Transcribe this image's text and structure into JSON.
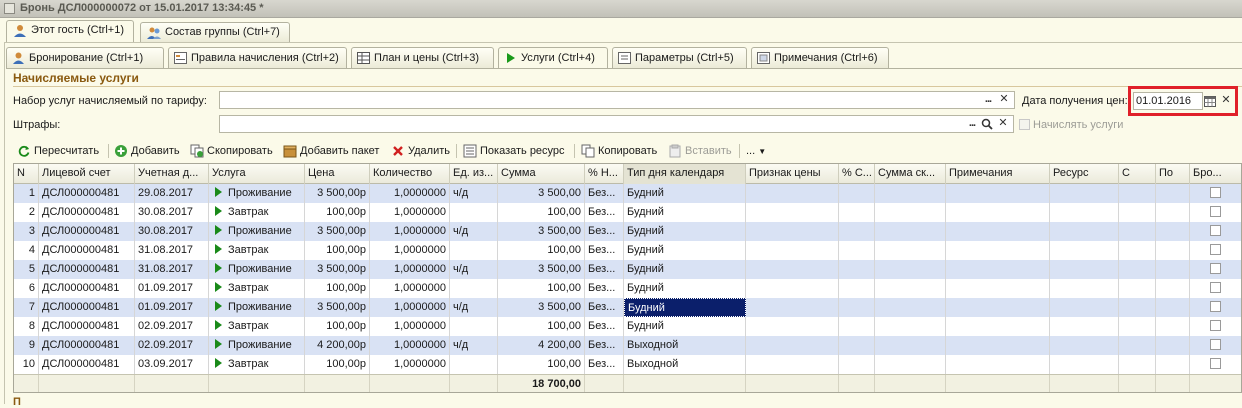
{
  "window": {
    "title": "Бронь ДСЛ000000072 от 15.01.2017 13:34:45 *"
  },
  "top_tabs": [
    {
      "label": "Этот гость (Ctrl+1)",
      "icon": "person-icon",
      "active": true
    },
    {
      "label": "Состав группы (Ctrl+7)",
      "icon": "group-icon",
      "active": false
    }
  ],
  "inner_tabs": [
    {
      "label": "Бронирование (Ctrl+1)",
      "icon": "person-icon",
      "active": false
    },
    {
      "label": "Правила начисления (Ctrl+2)",
      "icon": "rules-icon",
      "active": false
    },
    {
      "label": "План и цены (Ctrl+3)",
      "icon": "table-icon",
      "active": false
    },
    {
      "label": "Услуги (Ctrl+4)",
      "icon": "play-icon",
      "active": true
    },
    {
      "label": "Параметры (Ctrl+5)",
      "icon": "params-icon",
      "active": false
    },
    {
      "label": "Примечания (Ctrl+6)",
      "icon": "notes-icon",
      "active": false
    }
  ],
  "section": {
    "title": "Начисляемые услуги"
  },
  "form": {
    "tariff_label": "Набор услуг начисляемый по тарифу:",
    "tariff_value": "",
    "fines_label": "Штрафы:",
    "fines_value": "",
    "date_label": "Дата получения цен:",
    "date_value": "01.01.2016",
    "charge_services_label": "Начислять услуги",
    "charge_services_checked": false,
    "dots": "..."
  },
  "toolbar": {
    "recalc": "Пересчитать",
    "add": "Добавить",
    "copy": "Скопировать",
    "add_package": "Добавить пакет",
    "delete": "Удалить",
    "show_resource": "Показать ресурс",
    "copy2": "Копировать",
    "paste": "Вставить",
    "more": "..."
  },
  "grid": {
    "columns": [
      "N",
      "Лицевой счет",
      "Учетная д...",
      "Услуга",
      "Цена",
      "Количество",
      "Ед. из...",
      "Сумма",
      "% Н...",
      "Тип дня календаря",
      "Признак цены",
      "% С...",
      "Сумма ск...",
      "Примечания",
      "Ресурс",
      "С",
      "По",
      "Бро..."
    ],
    "rows": [
      {
        "n": "1",
        "account": "ДСЛ000000481",
        "date": "29.08.2017",
        "service": "Проживание",
        "price": "3 500,00р",
        "qty": "1,0000000",
        "unit": "ч/д",
        "sum": "3 500,00",
        "vat": "Без...",
        "daytype": "Будний"
      },
      {
        "n": "2",
        "account": "ДСЛ000000481",
        "date": "30.08.2017",
        "service": "Завтрак",
        "price": "100,00р",
        "qty": "1,0000000",
        "unit": "",
        "sum": "100,00",
        "vat": "Без...",
        "daytype": "Будний"
      },
      {
        "n": "3",
        "account": "ДСЛ000000481",
        "date": "30.08.2017",
        "service": "Проживание",
        "price": "3 500,00р",
        "qty": "1,0000000",
        "unit": "ч/д",
        "sum": "3 500,00",
        "vat": "Без...",
        "daytype": "Будний"
      },
      {
        "n": "4",
        "account": "ДСЛ000000481",
        "date": "31.08.2017",
        "service": "Завтрак",
        "price": "100,00р",
        "qty": "1,0000000",
        "unit": "",
        "sum": "100,00",
        "vat": "Без...",
        "daytype": "Будний"
      },
      {
        "n": "5",
        "account": "ДСЛ000000481",
        "date": "31.08.2017",
        "service": "Проживание",
        "price": "3 500,00р",
        "qty": "1,0000000",
        "unit": "ч/д",
        "sum": "3 500,00",
        "vat": "Без...",
        "daytype": "Будний"
      },
      {
        "n": "6",
        "account": "ДСЛ000000481",
        "date": "01.09.2017",
        "service": "Завтрак",
        "price": "100,00р",
        "qty": "1,0000000",
        "unit": "",
        "sum": "100,00",
        "vat": "Без...",
        "daytype": "Будний"
      },
      {
        "n": "7",
        "account": "ДСЛ000000481",
        "date": "01.09.2017",
        "service": "Проживание",
        "price": "3 500,00р",
        "qty": "1,0000000",
        "unit": "ч/д",
        "sum": "3 500,00",
        "vat": "Без...",
        "daytype": "Будний"
      },
      {
        "n": "8",
        "account": "ДСЛ000000481",
        "date": "02.09.2017",
        "service": "Завтрак",
        "price": "100,00р",
        "qty": "1,0000000",
        "unit": "",
        "sum": "100,00",
        "vat": "Без...",
        "daytype": "Будний"
      },
      {
        "n": "9",
        "account": "ДСЛ000000481",
        "date": "02.09.2017",
        "service": "Проживание",
        "price": "4 200,00р",
        "qty": "1,0000000",
        "unit": "ч/д",
        "sum": "4 200,00",
        "vat": "Без...",
        "daytype": "Выходной"
      },
      {
        "n": "10",
        "account": "ДСЛ000000481",
        "date": "03.09.2017",
        "service": "Завтрак",
        "price": "100,00р",
        "qty": "1,0000000",
        "unit": "",
        "sum": "100,00",
        "vat": "Без...",
        "daytype": "Выходной"
      }
    ],
    "selected_row": 7,
    "total_sum": "18 700,00"
  },
  "bottom": {
    "label": "П"
  },
  "colors": {
    "accent_title": "#8a5a10",
    "row_alt": "#d9e2f4",
    "selection": "#0b1f6b",
    "highlight_box": "#e0202a"
  }
}
